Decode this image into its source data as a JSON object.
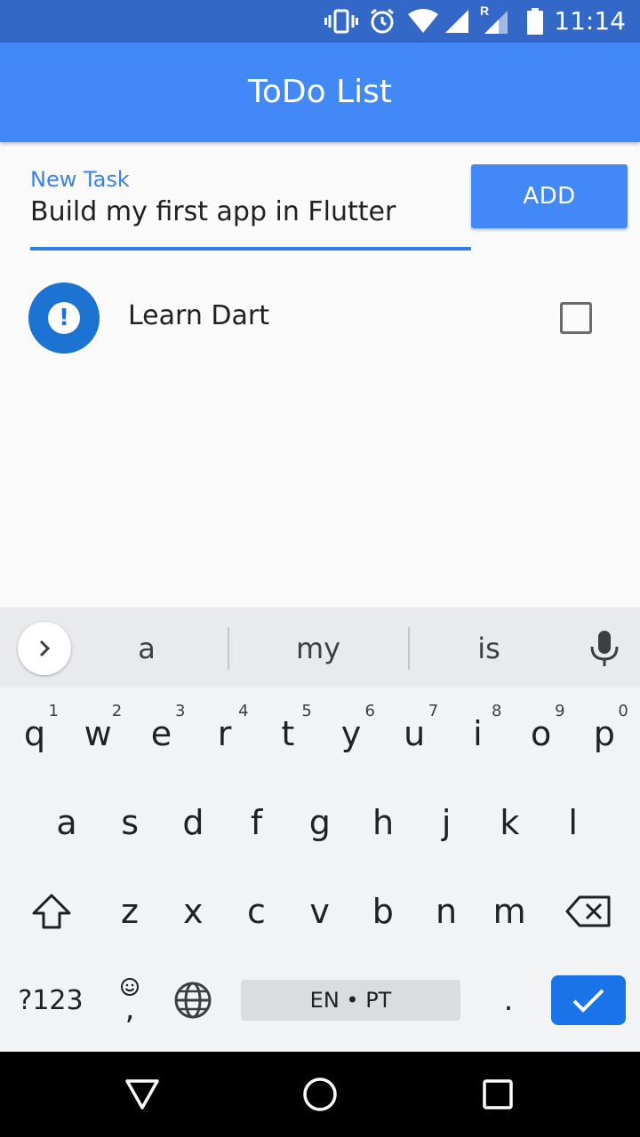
{
  "status_bar": {
    "time": "11:14",
    "icons": [
      "vibrate-icon",
      "alarm-icon",
      "wifi-icon",
      "signal-icon",
      "roaming-signal-icon",
      "battery-icon"
    ],
    "roaming_letter": "R"
  },
  "app_bar": {
    "title": "ToDo List"
  },
  "new_task": {
    "label": "New Task",
    "value": "Build my first app in Flutter"
  },
  "add_button": {
    "label": "ADD"
  },
  "tasks": [
    {
      "label": "Learn Dart",
      "icon": "priority-high-icon",
      "icon_glyph": "!",
      "checked": false
    }
  ],
  "keyboard": {
    "suggestions": [
      "a",
      "my",
      "is"
    ],
    "row1": [
      {
        "k": "q",
        "n": "1"
      },
      {
        "k": "w",
        "n": "2"
      },
      {
        "k": "e",
        "n": "3"
      },
      {
        "k": "r",
        "n": "4"
      },
      {
        "k": "t",
        "n": "5"
      },
      {
        "k": "y",
        "n": "6"
      },
      {
        "k": "u",
        "n": "7"
      },
      {
        "k": "i",
        "n": "8"
      },
      {
        "k": "o",
        "n": "9"
      },
      {
        "k": "p",
        "n": "0"
      }
    ],
    "row2": [
      "a",
      "s",
      "d",
      "f",
      "g",
      "h",
      "j",
      "k",
      "l"
    ],
    "row3": [
      "z",
      "x",
      "c",
      "v",
      "b",
      "n",
      "m"
    ],
    "symbols_label": "?123",
    "comma_label": ",",
    "space_label": "EN • PT",
    "period_label": ".",
    "accent_color": "#1a73e8"
  },
  "colors": {
    "status_bar": "#3367c8",
    "app_bar": "#4288f7",
    "avatar": "#1c73d1"
  }
}
